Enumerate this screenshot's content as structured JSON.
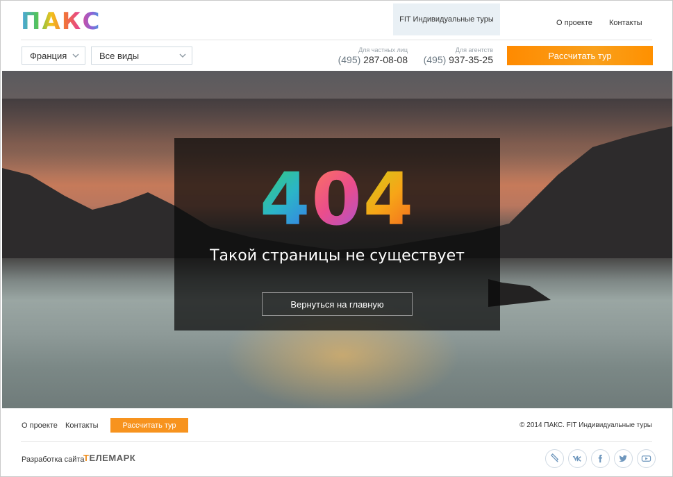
{
  "header": {
    "logo_text": "ПАКС",
    "fit_tab": "FIT Индивидуальные туры",
    "nav": {
      "about": "О проекте",
      "contacts": "Контакты"
    },
    "country_select": "Франция",
    "type_select": "Все виды",
    "phone_private": {
      "caption": "Для частных лиц",
      "code": "(495)",
      "number": "287-08-08"
    },
    "phone_agents": {
      "caption": "Для агентств",
      "code": "(495)",
      "number": "937-35-25"
    },
    "cta": "Рассчитать тур"
  },
  "error": {
    "code_digits": [
      "4",
      "0",
      "4"
    ],
    "title": "Такой страницы не существует",
    "home_button": "Вернуться на главную"
  },
  "footer": {
    "about": "О проекте",
    "contacts": "Контакты",
    "cta": "Рассчитать тур",
    "copyright": "© 2014 ПАКС. FIT Индивидуальные туры",
    "dev_label": "Разработка сайта",
    "dev_logo": {
      "first": "Т",
      "rest": "ЕЛЕМАРК"
    },
    "socials": [
      "livejournal-icon",
      "vk-icon",
      "facebook-icon",
      "twitter-icon",
      "youtube-icon"
    ]
  },
  "colors": {
    "accent": "#f7931e",
    "select_border": "#cfd8df"
  }
}
